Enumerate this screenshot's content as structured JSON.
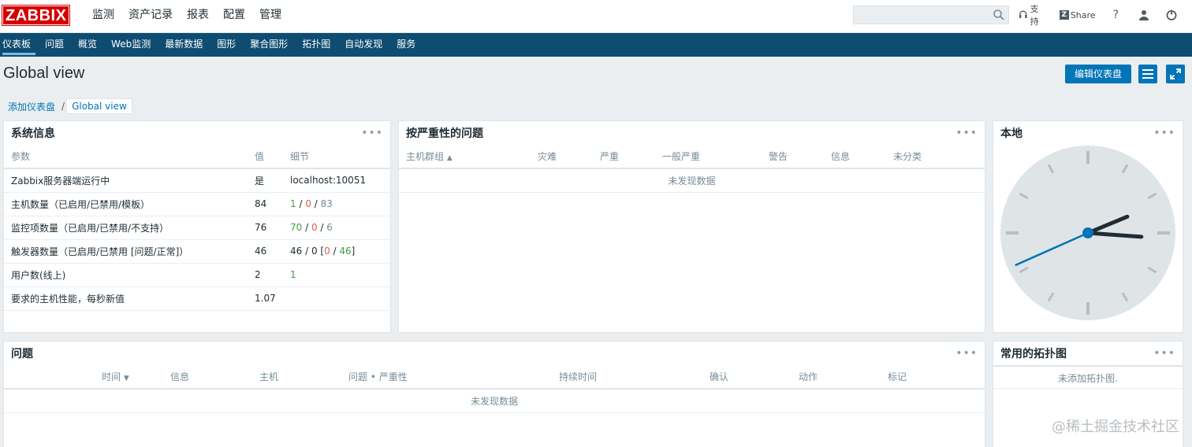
{
  "header": {
    "logo": "ZABBIX",
    "menu": [
      "监测",
      "资产记录",
      "报表",
      "配置",
      "管理"
    ],
    "search_placeholder": "",
    "support": "支持",
    "share_badge": "Z",
    "share": "Share",
    "help": "?"
  },
  "subnav": [
    "仪表板",
    "问题",
    "概览",
    "Web监测",
    "最新数据",
    "图形",
    "聚合图形",
    "拓扑图",
    "自动发现",
    "服务"
  ],
  "page": {
    "title": "Global view",
    "edit_button": "编辑仪表盘",
    "breadcrumb": {
      "parent": "添加仪表盘",
      "sep": "/",
      "current": "Global view"
    }
  },
  "sysinfo": {
    "title": "系统信息",
    "headers": [
      "参数",
      "值",
      "细节"
    ],
    "rows": [
      {
        "param": "Zabbix服务器端运行中",
        "value": "是",
        "detail": "localhost:10051"
      },
      {
        "param": "主机数量（已启用/已禁用/模板）",
        "value": "84",
        "d1": "1",
        "d2": "0",
        "d3": "83"
      },
      {
        "param": "监控项数量（已启用/已禁用/不支持）",
        "value": "76",
        "d1": "70",
        "d2": "0",
        "d3": "6"
      },
      {
        "param": "触发器数量（已启用/已禁用 [问题/正常]）",
        "value": "46",
        "d0": "46 / 0 [",
        "d2": "0",
        "d3": "46",
        "d4": "]"
      },
      {
        "param": "用户数(线上)",
        "value": "2",
        "d1": "1"
      },
      {
        "param": "要求的主机性能，每秒新值",
        "value": "1.07"
      }
    ]
  },
  "severity": {
    "title": "按严重性的问题",
    "headers": [
      "主机群组",
      "灾难",
      "严重",
      "一般严重",
      "警告",
      "信息",
      "未分类"
    ],
    "sort_indicator": "▲",
    "nodata": "未发现数据"
  },
  "clock": {
    "title": "本地",
    "hour": 2,
    "minute": 15,
    "second": 41
  },
  "problems": {
    "title": "问题",
    "headers": [
      "时间",
      "信息",
      "主机",
      "问题 • 严重性",
      "持续时间",
      "确认",
      "动作",
      "标记"
    ],
    "sort_indicator": "▼",
    "nodata": "未发现数据"
  },
  "maps": {
    "title": "常用的拓扑图",
    "empty": "未添加拓扑图."
  },
  "widget_menu": "•••",
  "watermark": "@稀土掘金技术社区",
  "colors": {
    "accent": "#0275b8",
    "nav": "#0e4c71",
    "ok": "#429e47",
    "problem": "#e45959",
    "logo": "#d40000"
  }
}
